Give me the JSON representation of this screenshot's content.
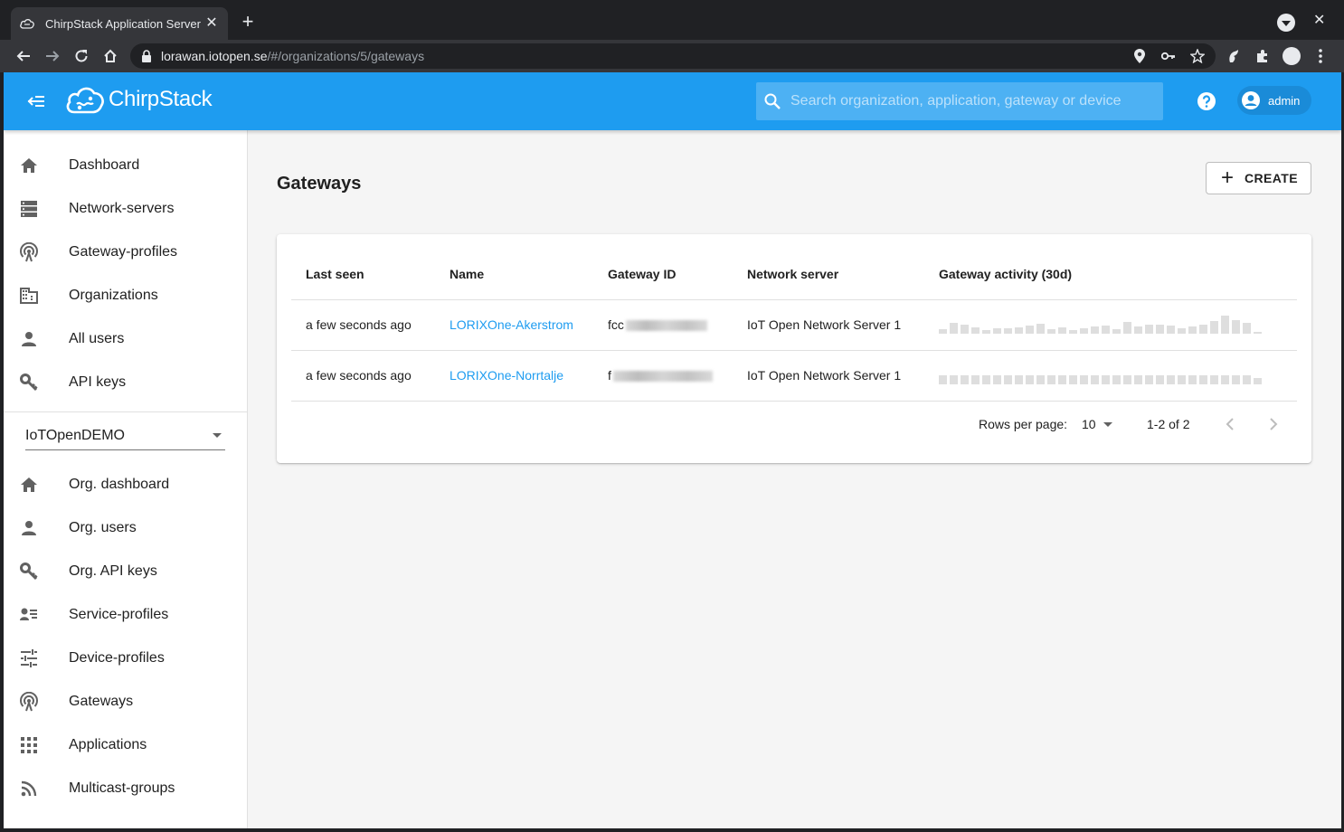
{
  "browser": {
    "tab_title": "ChirpStack Application Server",
    "url_host": "lorawan.iotopen.se",
    "url_path": "/#/organizations/5/gateways"
  },
  "appbar": {
    "logo_text": "ChirpStack",
    "search_placeholder": "Search organization, application, gateway or device",
    "user_label": "admin",
    "color": "#1e9cf0"
  },
  "sidebar": {
    "global_items": [
      {
        "label": "Dashboard",
        "icon": "home-icon"
      },
      {
        "label": "Network-servers",
        "icon": "server-icon"
      },
      {
        "label": "Gateway-profiles",
        "icon": "antenna-icon"
      },
      {
        "label": "Organizations",
        "icon": "building-icon"
      },
      {
        "label": "All users",
        "icon": "person-icon"
      },
      {
        "label": "API keys",
        "icon": "key-icon"
      }
    ],
    "org_selected": "IoTOpenDEMO",
    "org_items": [
      {
        "label": "Org. dashboard",
        "icon": "home-icon"
      },
      {
        "label": "Org. users",
        "icon": "person-icon"
      },
      {
        "label": "Org. API keys",
        "icon": "key-icon"
      },
      {
        "label": "Service-profiles",
        "icon": "account-details-icon"
      },
      {
        "label": "Device-profiles",
        "icon": "tune-icon"
      },
      {
        "label": "Gateways",
        "icon": "antenna-icon"
      },
      {
        "label": "Applications",
        "icon": "apps-icon"
      },
      {
        "label": "Multicast-groups",
        "icon": "rss-icon"
      }
    ]
  },
  "main": {
    "title": "Gateways",
    "create_label": "CREATE",
    "table": {
      "headers": [
        "Last seen",
        "Name",
        "Gateway ID",
        "Network server",
        "Gateway activity (30d)"
      ],
      "rows": [
        {
          "last_seen": "a few seconds ago",
          "name": "LORIXOne-Akerstrom",
          "gateway_id": "fcc",
          "network_server": "IoT Open Network Server 1"
        },
        {
          "last_seen": "a few seconds ago",
          "name": "LORIXOne-Norrtalje",
          "gateway_id": "f",
          "network_server": "IoT Open Network Server 1"
        }
      ]
    },
    "pager": {
      "rows_per_page_label": "Rows per page:",
      "rows_per_page": "10",
      "range": "1-2 of 2"
    }
  }
}
